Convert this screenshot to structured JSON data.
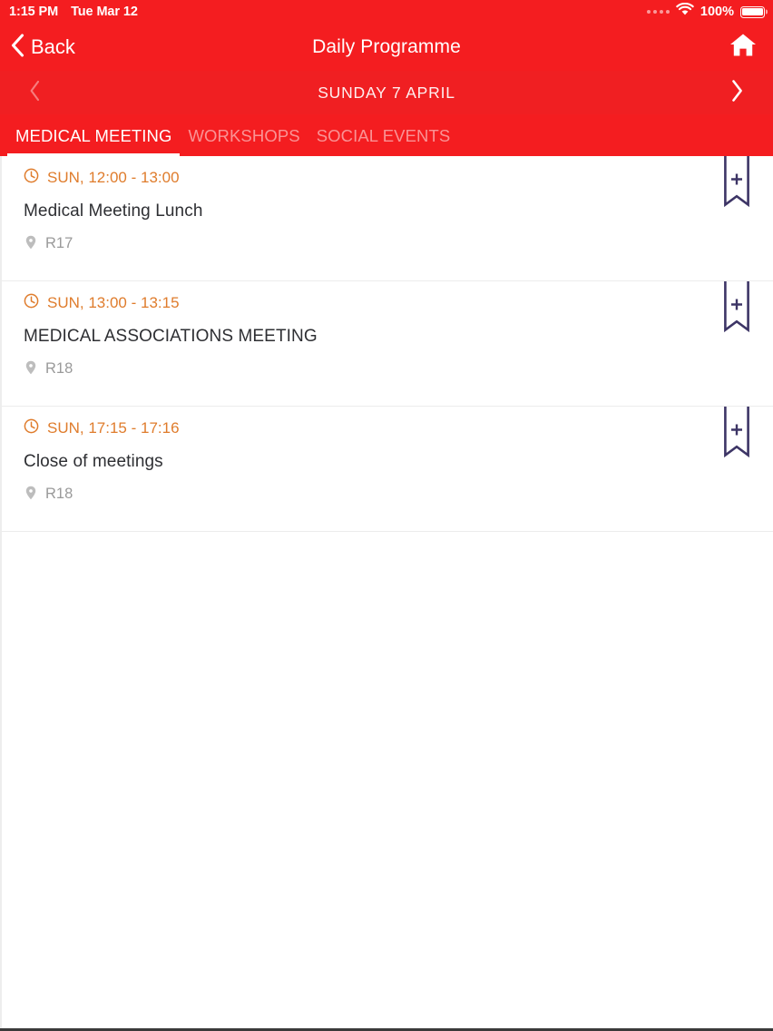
{
  "status_bar": {
    "time": "1:15 PM",
    "date": "Tue Mar 12",
    "battery_percent": "100%",
    "icons": {
      "signal": "signal-dots-icon",
      "wifi": "wifi-icon",
      "battery": "battery-full-icon"
    }
  },
  "nav_bar": {
    "back_label": "Back",
    "title": "Daily Programme",
    "back_icon": "chevron-left-icon",
    "home_icon": "home-icon"
  },
  "date_bar": {
    "label": "SUNDAY 7 APRIL",
    "prev_icon": "chevron-left-icon",
    "next_icon": "chevron-right-icon",
    "prev_enabled": false,
    "next_enabled": true
  },
  "tabs": [
    {
      "label": "MEDICAL MEETING",
      "active": true
    },
    {
      "label": "WORKSHOPS",
      "active": false
    },
    {
      "label": "SOCIAL EVENTS",
      "active": false
    }
  ],
  "events": [
    {
      "time": "SUN, 12:00 - 13:00",
      "title": "Medical Meeting Lunch",
      "location": "R17",
      "time_icon": "clock-icon",
      "location_icon": "map-pin-icon",
      "bookmark_icon": "bookmark-add-icon"
    },
    {
      "time": "SUN, 13:00 - 13:15",
      "title": "MEDICAL ASSOCIATIONS MEETING",
      "location": "R18",
      "time_icon": "clock-icon",
      "location_icon": "map-pin-icon",
      "bookmark_icon": "bookmark-add-icon"
    },
    {
      "time": "SUN, 17:15 - 17:16",
      "title": "Close of meetings",
      "location": "R18",
      "time_icon": "clock-icon",
      "location_icon": "map-pin-icon",
      "bookmark_icon": "bookmark-add-icon"
    }
  ],
  "colors": {
    "header_red": "#f41d20",
    "date_bar_red": "#f01f22",
    "time_orange": "#df7c2c",
    "title_text": "#2e2f33",
    "location_gray": "#9a9a9a",
    "bookmark_indigo": "#3d3566",
    "separator": "#ececec"
  }
}
